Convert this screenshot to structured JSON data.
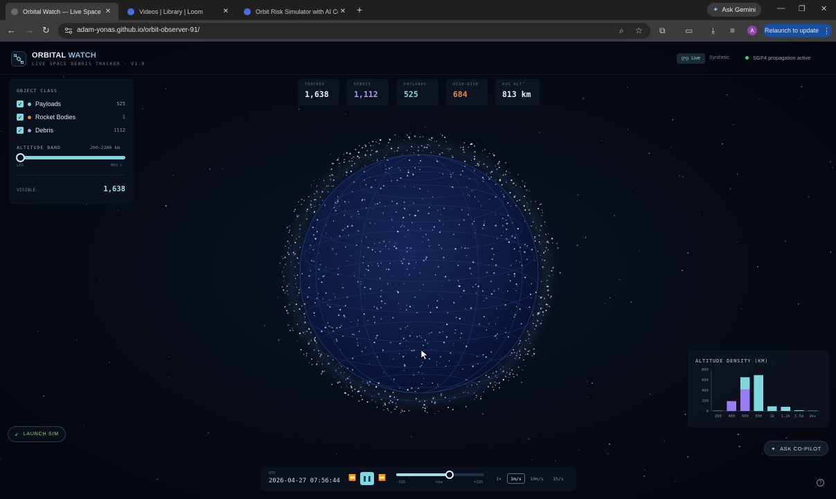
{
  "browser": {
    "tabs": [
      {
        "title": "Orbital Watch — Live Space De",
        "active": true
      },
      {
        "title": "Videos | Library | Loom",
        "active": false
      },
      {
        "title": "Orbit Risk Simulator with AI Co",
        "active": false
      }
    ],
    "new_tab": "+",
    "ask_gemini": "Ask Gemini",
    "url": "adam-yonas.github.io/orbit-observer-91/",
    "avatar_letter": "A",
    "relaunch": "Relaunch to update"
  },
  "header": {
    "brand_a": "ORBITAL ",
    "brand_b": "WATCH",
    "subtitle": "LIVE SPACE DEBRIS TRACKER · V1.0",
    "live": "Live",
    "synthetic": "Synthetic",
    "status": "SGP4 propagation active"
  },
  "stats": [
    {
      "label": "TRACKED",
      "value": "1,638",
      "color": "#e6eef8"
    },
    {
      "label": "DEBRIS",
      "value": "1,112",
      "color": "#a89cf0"
    },
    {
      "label": "PAYLOADS",
      "value": "525",
      "color": "#7fd8e0"
    },
    {
      "label": "HIGH-RISK",
      "value": "684",
      "color": "#e8864a"
    },
    {
      "label": "AVG ALT",
      "value": "813 km",
      "color": "#e6eef8"
    }
  ],
  "filters": {
    "title": "OBJECT CLASS",
    "classes": [
      {
        "name": "Payloads",
        "count": "525",
        "color": "#7fd8e0"
      },
      {
        "name": "Rocket Bodies",
        "count": "1",
        "color": "#e8864a"
      },
      {
        "name": "Debris",
        "count": "1112",
        "color": "#a89cf0"
      }
    ],
    "altitude_title": "ALTITUDE BAND",
    "altitude_range": "200–2200 km",
    "leo": "LEO",
    "meo": "MEO +",
    "visible_label": "VISIBLE",
    "visible_value": "1,638"
  },
  "launch_sim": "LAUNCH SIM",
  "copilot": "ASK CO-PILOT",
  "timeline": {
    "utc_label": "UTC",
    "utc_value": "2026-04-27 07:56:44",
    "ticks": [
      "-12h",
      "now",
      "+12h"
    ],
    "position_fraction": 0.58,
    "speeds": [
      "1×",
      "1m/s",
      "10m/s",
      "1h/s"
    ],
    "selected_speed": "1m/s"
  },
  "help": "?",
  "chart_data": {
    "type": "bar",
    "title": "ALTITUDE DENSITY (KM)",
    "categories": [
      "200",
      "400",
      "600",
      "800",
      "1k",
      "1.2k",
      "1.5k",
      "2k+"
    ],
    "series": [
      {
        "values": [
          0,
          190,
          420,
          0,
          0,
          0,
          0,
          0
        ],
        "color": "#9a7df0"
      },
      {
        "values": [
          5,
          0,
          230,
          690,
          90,
          80,
          15,
          5
        ],
        "color": "#7fd8e0"
      }
    ],
    "y_ticks": [
      "0",
      "200",
      "400",
      "600",
      "800"
    ],
    "ylim": [
      0,
      800
    ]
  }
}
